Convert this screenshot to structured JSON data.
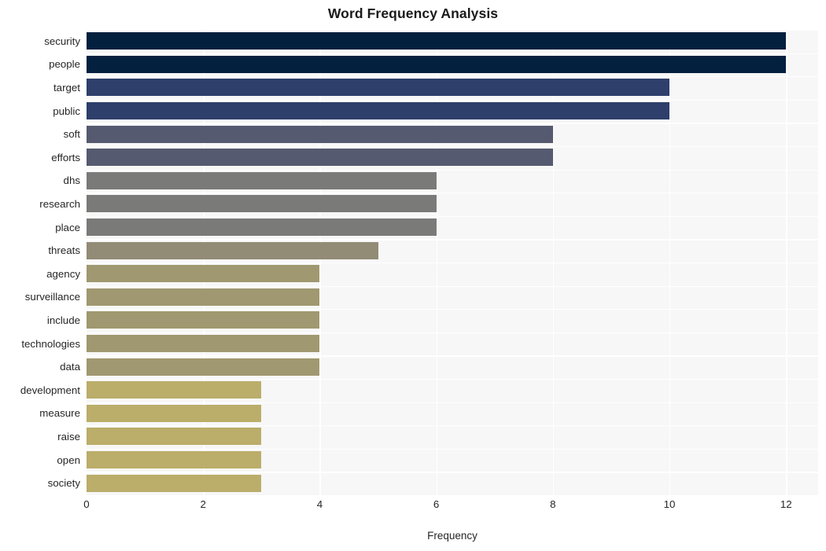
{
  "chart_data": {
    "type": "bar",
    "orientation": "horizontal",
    "title": "Word Frequency Analysis",
    "xlabel": "Frequency",
    "ylabel": "",
    "xlim": [
      0,
      12.55
    ],
    "xticks": [
      0,
      2,
      4,
      6,
      8,
      10,
      12
    ],
    "xticklabels": [
      "0",
      "2",
      "4",
      "6",
      "8",
      "10",
      "12"
    ],
    "grid": true,
    "grid_color": "#ffffff",
    "plot_background": "#f7f7f7",
    "legend": null,
    "categories": [
      "security",
      "people",
      "target",
      "public",
      "soft",
      "efforts",
      "dhs",
      "research",
      "place",
      "threats",
      "agency",
      "surveillance",
      "include",
      "technologies",
      "data",
      "development",
      "measure",
      "raise",
      "open",
      "society"
    ],
    "values": [
      12,
      12,
      10,
      10,
      8,
      8,
      6,
      6,
      6,
      5,
      4,
      4,
      4,
      4,
      4,
      3,
      3,
      3,
      3,
      3
    ],
    "bar_colors": [
      "#04203f",
      "#04203f",
      "#2e3f6b",
      "#2e3f6b",
      "#565a70",
      "#555a70",
      "#7a7a78",
      "#7a7a78",
      "#7a7a78",
      "#928b76",
      "#a09870",
      "#a09870",
      "#a09870",
      "#a09870",
      "#a09870",
      "#bbad6a",
      "#bbad6a",
      "#bbad6a",
      "#bbad6a",
      "#bbad6a"
    ]
  }
}
